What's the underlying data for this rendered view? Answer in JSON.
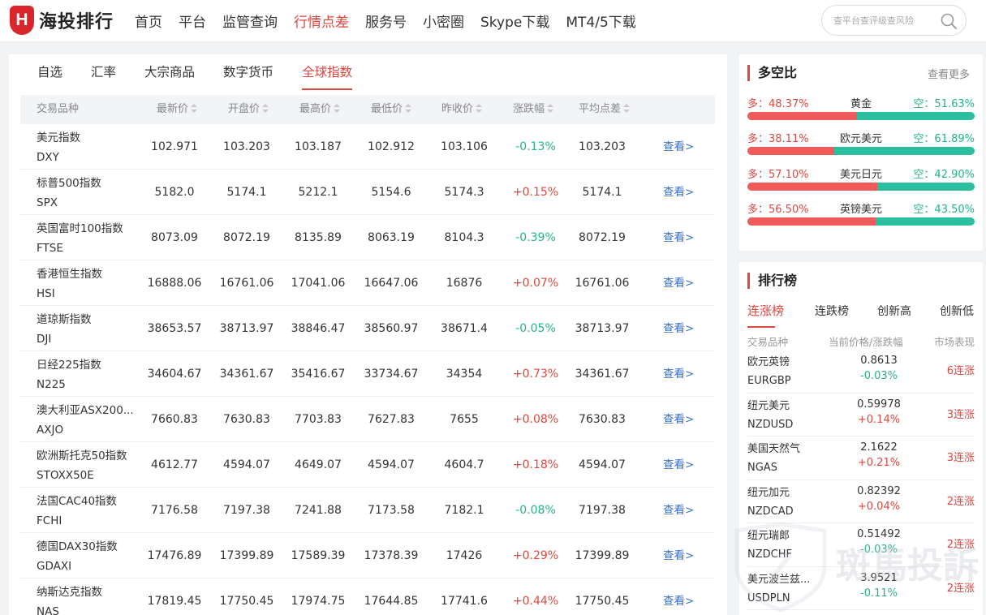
{
  "header": {
    "logo_text": "海投排行",
    "logo_letter": "H",
    "nav": [
      "首页",
      "平台",
      "监管查询",
      "行情点差",
      "服务号",
      "小密圈",
      "Skype下载",
      "MT4/5下载"
    ],
    "nav_active_index": 3,
    "search_placeholder": "查平台查评级查风险"
  },
  "main": {
    "tabs": [
      "自选",
      "汇率",
      "大宗商品",
      "数字货币",
      "全球指数"
    ],
    "active_tab_index": 4,
    "columns": [
      "交易品种",
      "最新价",
      "开盘价",
      "最高价",
      "最低价",
      "昨收价",
      "涨跌幅",
      "平均点差"
    ],
    "view_label": "查看>",
    "rows": [
      {
        "name": "美元指数",
        "code": "DXY",
        "last": "102.971",
        "open": "103.203",
        "high": "103.187",
        "low": "102.912",
        "prev": "103.106",
        "change": "-0.13%",
        "dir": "down",
        "spread": "103.203"
      },
      {
        "name": "标普500指数",
        "code": "SPX",
        "last": "5182.0",
        "open": "5174.1",
        "high": "5212.1",
        "low": "5154.6",
        "prev": "5174.3",
        "change": "+0.15%",
        "dir": "up",
        "spread": "5174.1"
      },
      {
        "name": "英国富时100指数",
        "code": "FTSE",
        "last": "8073.09",
        "open": "8072.19",
        "high": "8135.89",
        "low": "8063.19",
        "prev": "8104.3",
        "change": "-0.39%",
        "dir": "down",
        "spread": "8072.19"
      },
      {
        "name": "香港恒生指数",
        "code": "HSI",
        "last": "16888.06",
        "open": "16761.06",
        "high": "17041.06",
        "low": "16647.06",
        "prev": "16876",
        "change": "+0.07%",
        "dir": "up",
        "spread": "16761.06"
      },
      {
        "name": "道琼斯指数",
        "code": "DJI",
        "last": "38653.57",
        "open": "38713.97",
        "high": "38846.47",
        "low": "38560.97",
        "prev": "38671.4",
        "change": "-0.05%",
        "dir": "down",
        "spread": "38713.97"
      },
      {
        "name": "日经225指数",
        "code": "N225",
        "last": "34604.67",
        "open": "34361.67",
        "high": "35416.67",
        "low": "33734.67",
        "prev": "34354",
        "change": "+0.73%",
        "dir": "up",
        "spread": "34361.67"
      },
      {
        "name": "澳大利亚ASX200...",
        "code": "AXJO",
        "last": "7660.83",
        "open": "7630.83",
        "high": "7703.83",
        "low": "7627.83",
        "prev": "7655",
        "change": "+0.08%",
        "dir": "up",
        "spread": "7630.83"
      },
      {
        "name": "欧洲斯托克50指数",
        "code": "STOXX50E",
        "last": "4612.77",
        "open": "4594.07",
        "high": "4649.07",
        "low": "4594.07",
        "prev": "4604.7",
        "change": "+0.18%",
        "dir": "up",
        "spread": "4594.07"
      },
      {
        "name": "法国CAC40指数",
        "code": "FCHI",
        "last": "7176.58",
        "open": "7197.38",
        "high": "7241.88",
        "low": "7173.58",
        "prev": "7182.1",
        "change": "-0.08%",
        "dir": "down",
        "spread": "7197.38"
      },
      {
        "name": "德国DAX30指数",
        "code": "GDAXI",
        "last": "17476.89",
        "open": "17399.89",
        "high": "17589.39",
        "low": "17378.39",
        "prev": "17426",
        "change": "+0.29%",
        "dir": "up",
        "spread": "17399.89"
      },
      {
        "name": "纳斯达克指数",
        "code": "NAS",
        "last": "17819.45",
        "open": "17750.45",
        "high": "17974.75",
        "low": "17644.85",
        "prev": "17741.6",
        "change": "+0.44%",
        "dir": "up",
        "spread": "17750.45"
      }
    ]
  },
  "ratio": {
    "title": "多空比",
    "more": "查看更多",
    "items": [
      {
        "pair": "黄金",
        "long": "多：48.37%",
        "short": "空：51.63%",
        "long_pct": 48.37
      },
      {
        "pair": "欧元美元",
        "long": "多：38.11%",
        "short": "空：61.89%",
        "long_pct": 38.11
      },
      {
        "pair": "美元日元",
        "long": "多：57.10%",
        "short": "空：42.90%",
        "long_pct": 57.1
      },
      {
        "pair": "英镑美元",
        "long": "多：56.50%",
        "short": "空：43.50%",
        "long_pct": 56.5
      }
    ]
  },
  "ranking": {
    "title": "排行榜",
    "tabs": [
      "连涨榜",
      "连跌榜",
      "创新高",
      "创新低"
    ],
    "active_tab_index": 0,
    "headers": [
      "交易品种",
      "当前价格/涨跌幅",
      "市场表现"
    ],
    "rows": [
      {
        "name": "欧元英镑",
        "code": "EURGBP",
        "price": "0.8613",
        "change": "-0.03%",
        "dir": "down",
        "streak": "6连涨"
      },
      {
        "name": "纽元美元",
        "code": "NZDUSD",
        "price": "0.59978",
        "change": "+0.14%",
        "dir": "up",
        "streak": "3连涨"
      },
      {
        "name": "美国天然气",
        "code": "NGAS",
        "price": "2.1622",
        "change": "+0.21%",
        "dir": "up",
        "streak": "3连涨"
      },
      {
        "name": "纽元加元",
        "code": "NZDCAD",
        "price": "0.82392",
        "change": "+0.04%",
        "dir": "up",
        "streak": "2连涨"
      },
      {
        "name": "纽元瑞郎",
        "code": "NZDCHF",
        "price": "0.51492",
        "change": "-0.03%",
        "dir": "down",
        "streak": "2连涨"
      },
      {
        "name": "美元波兰兹...",
        "code": "USDPLN",
        "price": "3.9521",
        "change": "-0.11%",
        "dir": "down",
        "streak": "2连涨"
      }
    ]
  },
  "watermark": {
    "text": "斑馬投訴"
  },
  "colors": {
    "accent": "#e0473f",
    "up": "#e0473f",
    "down": "#25b38a",
    "link": "#3d6fc6"
  }
}
